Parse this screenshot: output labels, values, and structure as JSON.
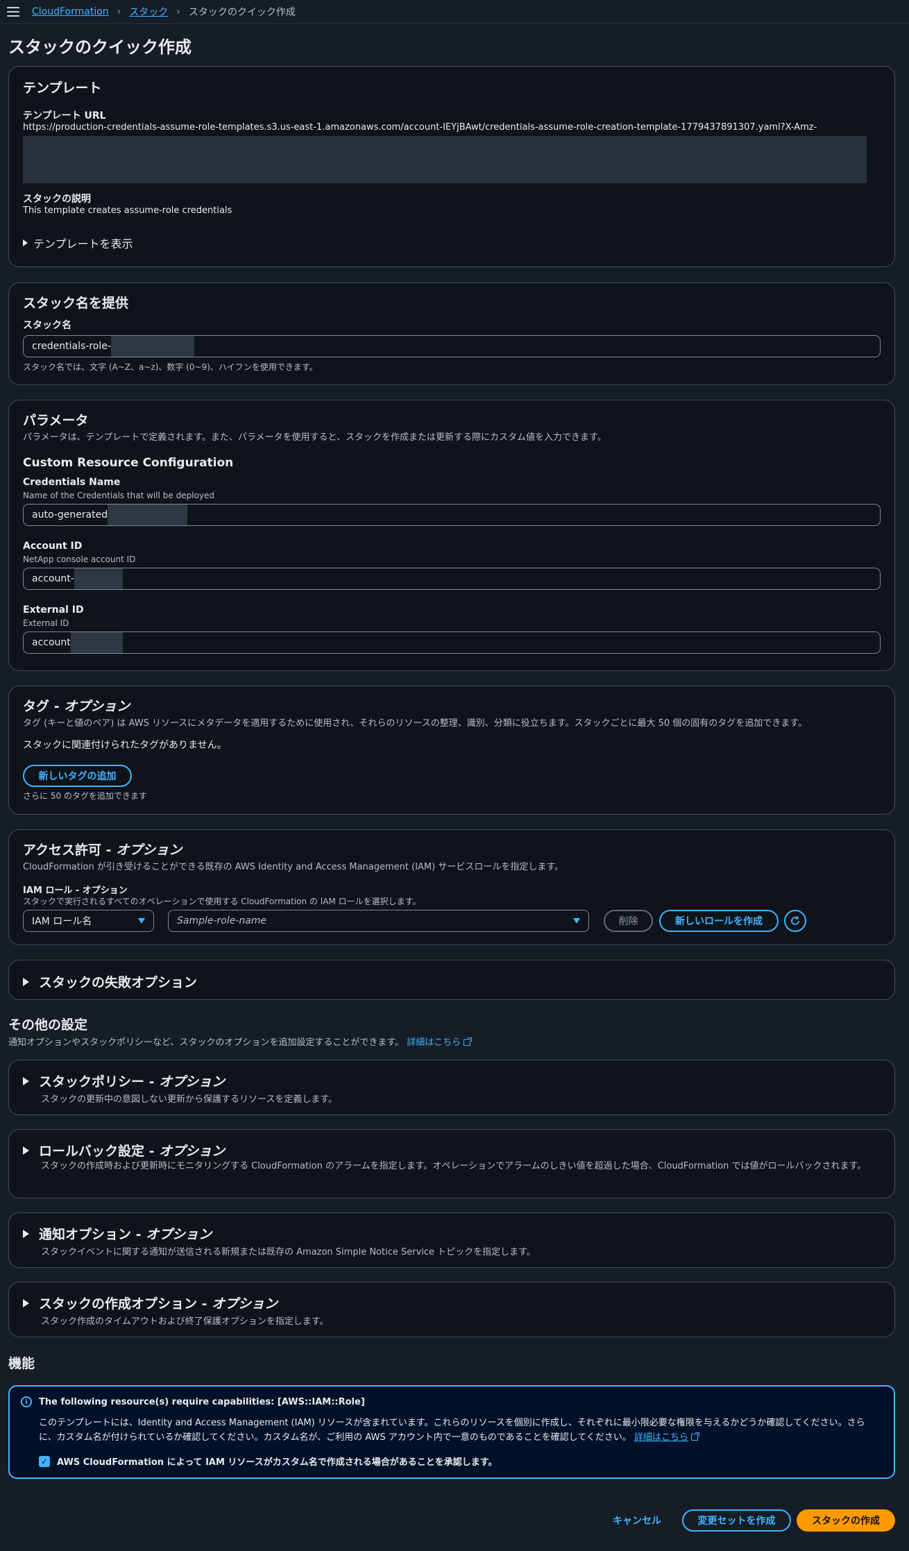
{
  "breadcrumb": {
    "items": [
      "CloudFormation",
      "スタック",
      "スタックのクイック作成"
    ]
  },
  "page": {
    "title": "スタックのクイック作成"
  },
  "template": {
    "heading": "テンプレート",
    "url_label": "テンプレート URL",
    "url_value": "https://production-credentials-assume-role-templates.s3.us-east-1.amazonaws.com/account-IEYjBAwt/credentials-assume-role-creation-template-1779437891307.yaml?X-Amz-",
    "desc_label": "スタックの説明",
    "desc_value": "This template creates assume-role credentials",
    "view_label": "テンプレートを表示"
  },
  "stack_name": {
    "heading": "スタック名を提供",
    "label": "スタック名",
    "value": "credentials-role-",
    "hint": "スタック名では、文字 (A~Z、a~z)、数字 (0~9)、ハイフンを使用できます。"
  },
  "parameters": {
    "heading": "パラメータ",
    "desc": "パラメータは、テンプレートで定義されます。また、パラメータを使用すると、スタックを作成または更新する際にカスタム値を入力できます。",
    "group_title": "Custom Resource Configuration",
    "fields": [
      {
        "label": "Credentials Name",
        "hint": "Name of the Credentials that will be deployed",
        "value": "auto-generated"
      },
      {
        "label": "Account ID",
        "hint": "NetApp console account ID",
        "value": "account-"
      },
      {
        "label": "External ID",
        "hint": "External ID",
        "value": "account"
      }
    ]
  },
  "tags": {
    "heading": "タグ",
    "heading_suffix": "オプション",
    "desc": "タグ (キーと値のペア) は AWS リソースにメタデータを適用するために使用され、それらのリソースの整理、識別、分類に役立ちます。スタックごとに最大 50 個の固有のタグを追加できます。",
    "empty": "スタックに関連付けられたタグがありません。",
    "add_button": "新しいタグの追加",
    "remaining": "さらに 50 のタグを追加できます"
  },
  "permissions": {
    "heading": "アクセス許可",
    "heading_suffix": "オプション",
    "desc": "CloudFormation が引き受けることができる既存の AWS Identity and Access Management (IAM) サービスロールを指定します。",
    "iam_label": "IAM ロール - オプション",
    "iam_hint": "スタックで実行されるすべてのオペレーションで使用する CloudFormation の IAM ロールを選択します。",
    "type_select": "IAM ロール名",
    "role_placeholder": "Sample-role-name",
    "delete_button": "削除",
    "new_role_button": "新しいロールを作成"
  },
  "failure_options": {
    "heading": "スタックの失敗オプション"
  },
  "other_settings": {
    "heading": "その他の設定",
    "desc": "通知オプションやスタックポリシーなど、スタックのオプションを追加設定することができます。",
    "learn_more": "詳細はこちら",
    "sections": [
      {
        "title": "スタックポリシー",
        "suffix": "オプション",
        "desc": "スタックの更新中の意図しない更新から保護するリソースを定義します。"
      },
      {
        "title": "ロールバック設定",
        "suffix": "オプション",
        "desc": "スタックの作成時および更新時にモニタリングする CloudFormation のアラームを指定します。オペレーションでアラームのしきい値を超過した場合、CloudFormation では値がロールバックされます。"
      },
      {
        "title": "通知オプション",
        "suffix": "オプション",
        "desc": "スタックイベントに関する通知が送信される新規または既存の Amazon Simple Notice Service トピックを指定します。"
      },
      {
        "title": "スタックの作成オプション",
        "suffix": "オプション",
        "desc": "スタック作成のタイムアウトおよび終了保護オプションを指定します。"
      }
    ]
  },
  "capabilities": {
    "heading": "機能",
    "alert_title": "The following resource(s) require capabilities: [AWS::IAM::Role]",
    "alert_body": "このテンプレートには、Identity and Access Management (IAM) リソースが含まれています。これらのリソースを個別に作成し、それぞれに最小限必要な権限を与えるかどうか確認してください。さらに、カスタム名が付けられているか確認してください。カスタム名が、ご利用の AWS アカウント内で一意のものであることを確認してください。",
    "learn_more": "詳細はこちら",
    "ack_label": "AWS CloudFormation によって IAM リソースがカスタム名で作成される場合があることを承認します。"
  },
  "footer": {
    "cancel": "キャンセル",
    "change_set": "変更セットを作成",
    "create": "スタックの作成"
  }
}
